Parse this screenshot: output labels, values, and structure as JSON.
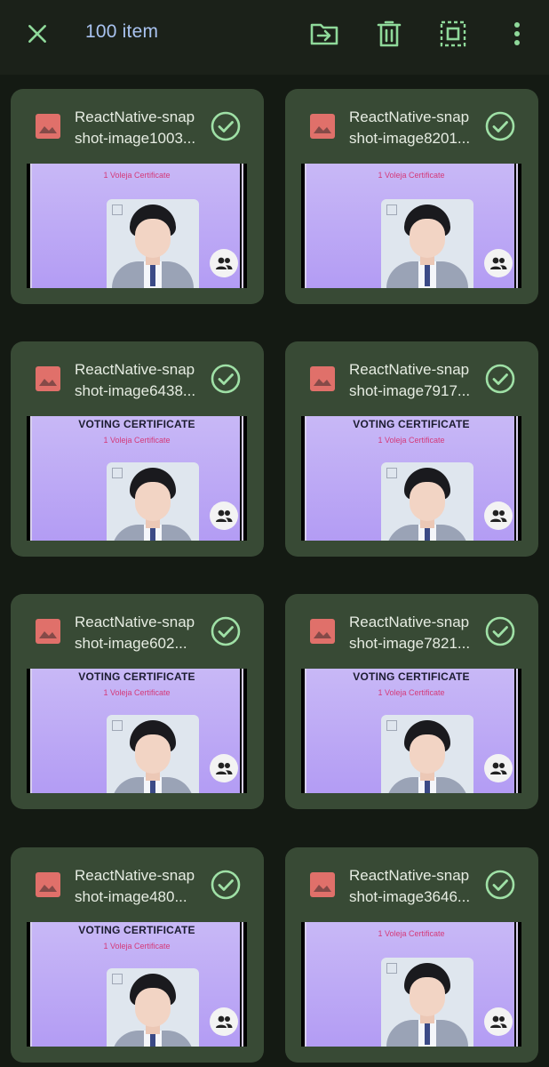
{
  "topbar": {
    "count_label": "100 item",
    "icons": [
      "close-icon",
      "move-to-folder-icon",
      "delete-icon",
      "select-all-icon",
      "more-vert-icon"
    ],
    "accent_color": "#8fd99a"
  },
  "cards": [
    {
      "name_line1": "ReactNative-snap",
      "name_line2": "shot-image1003...",
      "heading": "",
      "subtitle": "1 Voleja Certificate",
      "selected": true
    },
    {
      "name_line1": "ReactNative-snap",
      "name_line2": "shot-image8201...",
      "heading": "",
      "subtitle": "1 Voleja Certificate",
      "selected": true
    },
    {
      "name_line1": "ReactNative-snap",
      "name_line2": "shot-image6438...",
      "heading": "VOTING CERTIFICATE",
      "subtitle": "1 Voleja Certificate",
      "selected": true
    },
    {
      "name_line1": "ReactNative-snap",
      "name_line2": "shot-image7917...",
      "heading": "VOTING CERTIFICATE",
      "subtitle": "1 Voleja Certificate",
      "selected": true
    },
    {
      "name_line1": "ReactNative-snap",
      "name_line2": "shot-image602...",
      "heading": "VOTING CERTIFICATE",
      "subtitle": "1 Voleja Certificate",
      "selected": true
    },
    {
      "name_line1": "ReactNative-snap",
      "name_line2": "shot-image7821...",
      "heading": "VOTING CERTIFICATE",
      "subtitle": "1 Voleja Certificate",
      "selected": true
    },
    {
      "name_line1": "ReactNative-snap",
      "name_line2": "shot-image480...",
      "heading": "VOTING CERTIFICATE",
      "subtitle": "1 Voleja Certificate",
      "selected": true
    },
    {
      "name_line1": "ReactNative-snap",
      "name_line2": "shot-image3646...",
      "heading": "",
      "subtitle": "1 Voleja Certificate",
      "selected": true
    }
  ]
}
